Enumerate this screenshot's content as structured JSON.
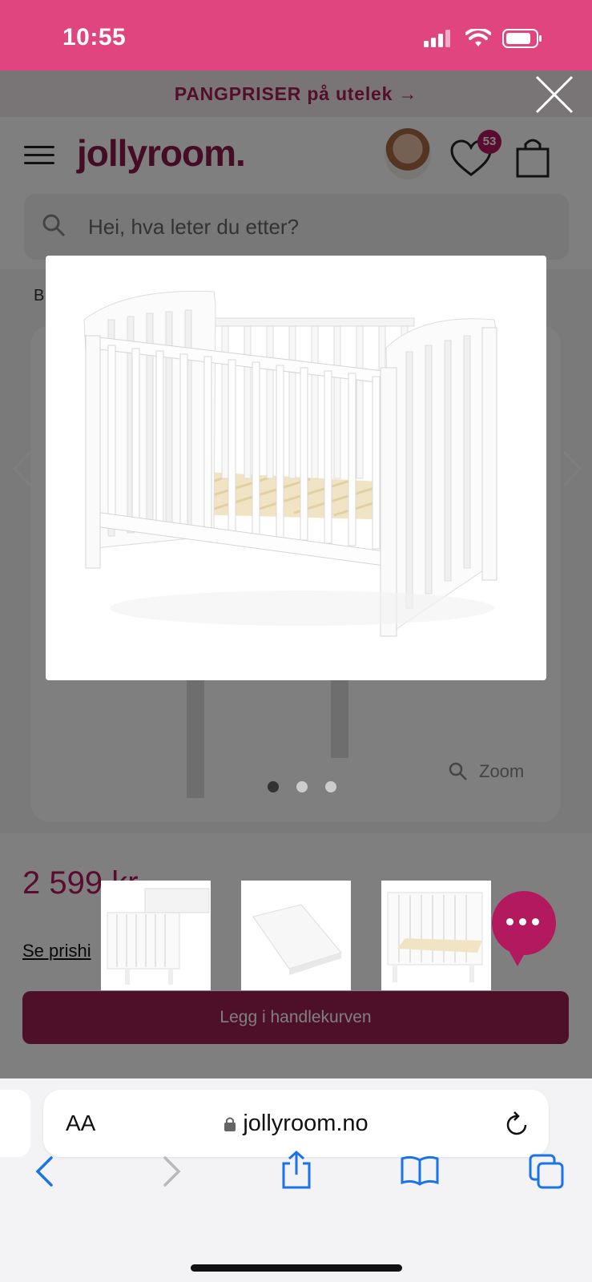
{
  "status": {
    "time": "10:55"
  },
  "promo": {
    "text": "PANGPRISER på utelek →"
  },
  "header": {
    "logo": "jollyroom.",
    "wishlist_count": "53"
  },
  "search": {
    "placeholder": "Hei, hva leter du etter?"
  },
  "breadcrumb": {
    "text": "B"
  },
  "gallery": {
    "zoom_label": "Zoom",
    "dots": 3,
    "active_dot": 0
  },
  "product": {
    "price": "2 599 kr",
    "price_history_link": "Se prishi",
    "add_to_cart": "Legg i handlekurven"
  },
  "browser": {
    "text_size": "AA",
    "url": "jollyroom.no"
  },
  "colors": {
    "brand": "#e0457f",
    "brand_dark": "#8a1a4a",
    "accent": "#b3195e",
    "ios_blue": "#1a73e8"
  },
  "icons": {
    "menu": "hamburger-icon",
    "wishlist": "heart-icon",
    "cart": "shopping-bag-icon",
    "search": "search-icon",
    "close": "close-icon",
    "prev": "chevron-left-icon",
    "next": "chevron-right-icon",
    "chat": "chat-icon",
    "share": "share-icon",
    "bookmarks": "book-icon",
    "tabs": "tabs-icon",
    "reload": "reload-icon",
    "lock": "lock-icon"
  }
}
